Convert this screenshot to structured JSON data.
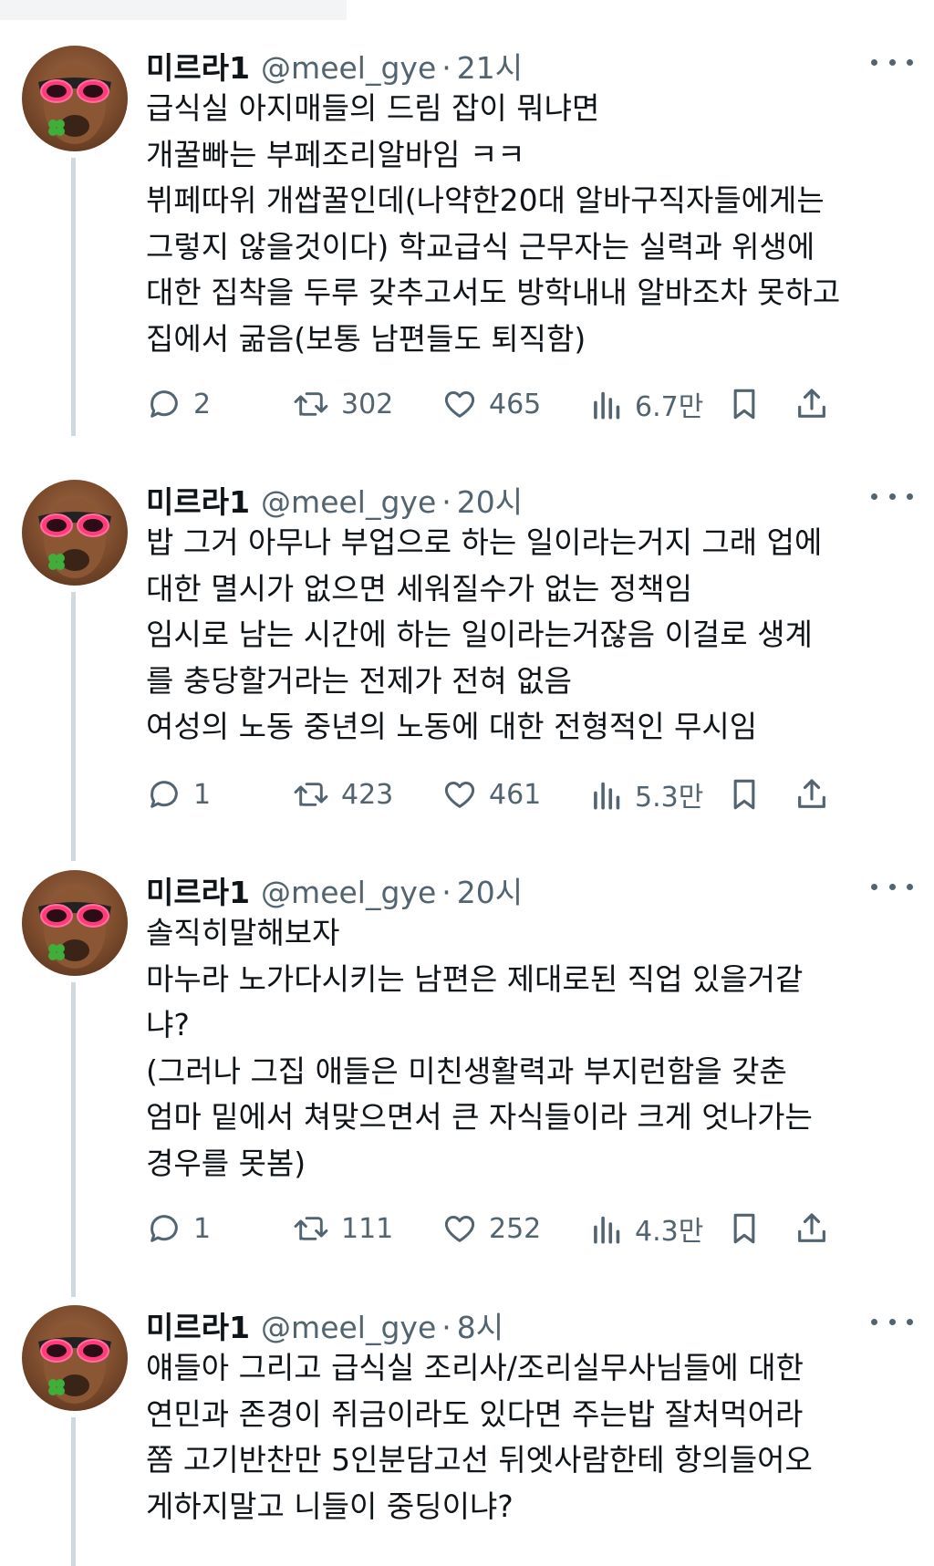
{
  "colors": {
    "text": "#0f1419",
    "secondary": "#536471",
    "thread_line": "#cfd9de",
    "background": "#ffffff"
  },
  "tweets": [
    {
      "name": "미르라1",
      "handle": "@meel_gye",
      "separator": "·",
      "time": "21시",
      "lines": [
        "급식실 아지매들의 드림 잡이 뭐냐면",
        "개꿀빠는 부페조리알바임 ㅋㅋ",
        "뷔페따위 개쌉꿀인데(나약한20대 알바구직자들에게는",
        "그렇지 않을것이다) 학교급식 근무자는 실력과 위생에",
        "대한 집착을 두루 갖추고서도 방학내내 알바조차 못하고",
        "집에서 굶음(보통 남편들도 퇴직함)"
      ],
      "replies": "2",
      "retweets": "302",
      "likes": "465",
      "views": "6.7만"
    },
    {
      "name": "미르라1",
      "handle": "@meel_gye",
      "separator": "·",
      "time": "20시",
      "lines": [
        "밥 그거 아무나 부업으로 하는 일이라는거지 그래 업에",
        "대한 멸시가 없으면 세워질수가 없는 정책임",
        "임시로 남는 시간에 하는 일이라는거잖음 이걸로 생계",
        "를 충당할거라는 전제가 전혀 없음",
        "여성의 노동 중년의 노동에 대한 전형적인 무시임"
      ],
      "replies": "1",
      "retweets": "423",
      "likes": "461",
      "views": "5.3만"
    },
    {
      "name": "미르라1",
      "handle": "@meel_gye",
      "separator": "·",
      "time": "20시",
      "lines": [
        "솔직히말해보자",
        "마누라 노가다시키는 남편은 제대로된 직업 있을거같",
        "냐?",
        "(그러나 그집 애들은 미친생활력과 부지런함을 갖춘",
        "엄마 밑에서 쳐맞으면서 큰 자식들이라 크게 엇나가는",
        "경우를 못봄)"
      ],
      "replies": "1",
      "retweets": "111",
      "likes": "252",
      "views": "4.3만"
    },
    {
      "name": "미르라1",
      "handle": "@meel_gye",
      "separator": "·",
      "time": "8시",
      "lines": [
        "얘들아 그리고 급식실 조리사/조리실무사님들에 대한",
        "연민과 존경이 쥐금이라도 있다면 주는밥 잘처먹어라",
        "쫌 고기반찬만 5인분담고선 뒤엣사람한테 항의들어오",
        "게하지말고 니들이 중딩이냐?"
      ]
    }
  ]
}
